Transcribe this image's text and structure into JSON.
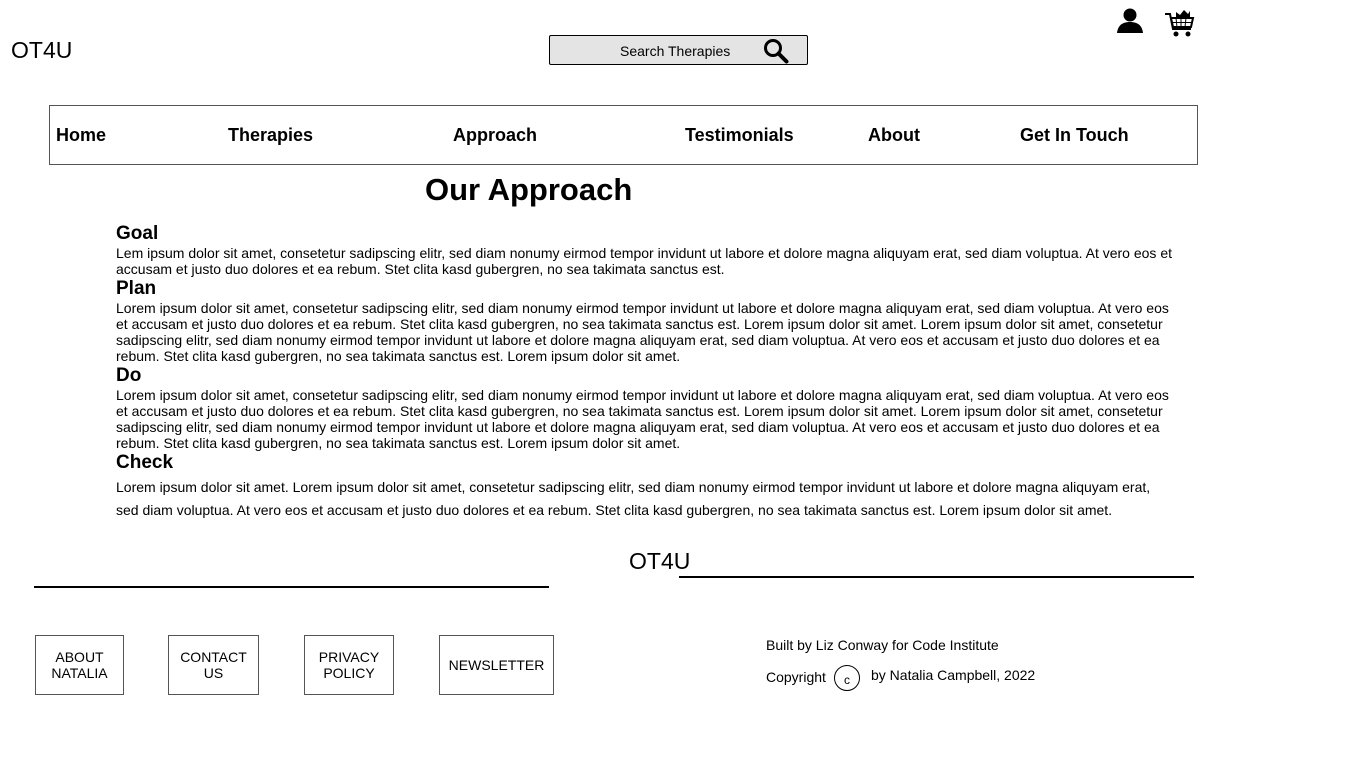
{
  "header": {
    "logo": "OT4U",
    "search": {
      "placeholder": "Search Therapies"
    },
    "icons": [
      "user-icon",
      "cart-icon",
      "search-icon"
    ]
  },
  "nav": {
    "items": [
      {
        "label": "Home"
      },
      {
        "label": "Therapies"
      },
      {
        "label": "Approach"
      },
      {
        "label": "Testimonials"
      },
      {
        "label": "About"
      },
      {
        "label": "Get In Touch"
      }
    ]
  },
  "main": {
    "title": "Our Approach",
    "sections": [
      {
        "heading": "Goal",
        "body": "Lem ipsum dolor sit amet, consetetur sadipscing elitr, sed diam nonumy eirmod tempor invidunt ut labore et dolore magna aliquyam erat, sed diam voluptua. At vero eos et accusam et justo duo dolores et ea rebum. Stet clita kasd gubergren, no sea takimata sanctus est."
      },
      {
        "heading": "Plan",
        "body": "Lorem ipsum dolor sit amet, consetetur sadipscing elitr, sed diam nonumy eirmod tempor invidunt ut labore et dolore magna aliquyam erat, sed diam voluptua. At vero eos et accusam et justo duo dolores et ea rebum. Stet clita kasd gubergren, no sea takimata sanctus est. Lorem ipsum dolor sit amet. Lorem ipsum dolor sit amet, consetetur sadipscing elitr, sed diam nonumy eirmod tempor invidunt ut labore et dolore magna aliquyam erat, sed diam voluptua. At vero eos et accusam et justo duo dolores et ea rebum. Stet clita kasd gubergren, no sea takimata sanctus est. Lorem ipsum dolor sit amet."
      },
      {
        "heading": "Do",
        "body": "Lorem ipsum dolor sit amet, consetetur sadipscing elitr, sed diam nonumy eirmod tempor invidunt ut labore et dolore magna aliquyam erat, sed diam voluptua. At vero eos et accusam et justo duo dolores et ea rebum. Stet clita kasd gubergren, no sea takimata sanctus est. Lorem ipsum dolor sit amet. Lorem ipsum dolor sit amet, consetetur sadipscing elitr, sed diam nonumy eirmod tempor invidunt ut labore et dolore magna aliquyam erat, sed diam voluptua. At vero eos et accusam et justo duo dolores et ea rebum. Stet clita kasd gubergren, no sea takimata sanctus est. Lorem ipsum dolor sit amet."
      },
      {
        "heading": "Check",
        "body": "Lorem ipsum dolor sit amet. Lorem ipsum dolor sit amet, consetetur sadipscing elitr, sed diam nonumy eirmod tempor invidunt ut labore et dolore magna aliquyam erat, sed diam voluptua. At vero eos et accusam et justo duo dolores et ea rebum. Stet clita kasd gubergren, no sea takimata sanctus est. Lorem ipsum dolor sit amet."
      }
    ]
  },
  "footer": {
    "logo": "OT4U",
    "links": [
      {
        "label": "ABOUT NATALIA"
      },
      {
        "label": "CONTACT US"
      },
      {
        "label": "PRIVACY POLICY"
      },
      {
        "label": "NEWSLETTER"
      }
    ],
    "built_by": "Built by Liz Conway for Code Institute",
    "copyright_label": "Copyright",
    "copyright_symbol": "c",
    "copyright_by": "by Natalia Campbell, 2022"
  }
}
